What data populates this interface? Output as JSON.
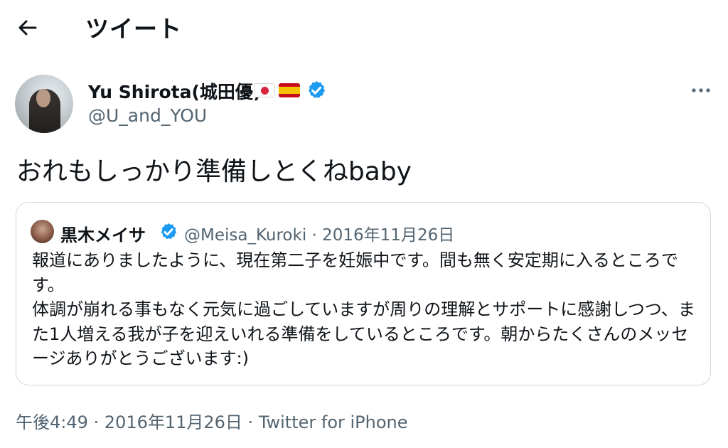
{
  "header": {
    "back_icon": "arrow-left-icon",
    "title": "ツイート"
  },
  "author": {
    "name": "Yu Shirota(城田優)",
    "flags": [
      "japan-flag-icon",
      "spain-flag-icon"
    ],
    "verified_icon": "verified-badge-icon",
    "handle": "@U_and_YOU",
    "more_icon": "more-options-icon"
  },
  "tweet": {
    "text": "おれもしっかり準備しとくねbaby"
  },
  "quoted": {
    "name": "黒木メイサ",
    "verified_icon": "verified-badge-icon",
    "meta": "@Meisa_Kuroki · 2016年11月26日",
    "paragraphs": [
      "報道にありましたように、現在第二子を妊娠中です。間も無く安定期に入るところです。",
      "体調が崩れる事もなく元気に過ごしていますが周りの理解とサポートに感謝しつつ、また1人増える我が子を迎えいれる準備をしているところです。朝からたくさんのメッセージありがとうございます:)"
    ]
  },
  "meta": {
    "timestamp": "午後4:49 · 2016年11月26日 · Twitter for iPhone"
  },
  "colors": {
    "text": "#0f1419",
    "secondary": "#536471",
    "verified": "#1d9bf0",
    "border": "#cfd9de"
  }
}
